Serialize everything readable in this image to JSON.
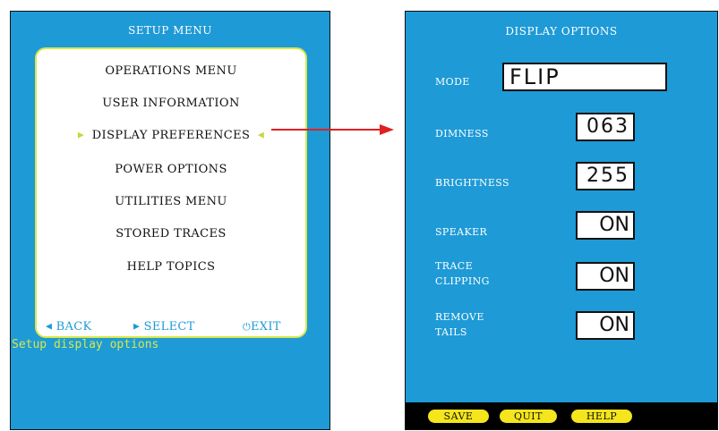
{
  "left": {
    "title": "SETUP MENU",
    "menu_items": [
      "OPERATIONS MENU",
      "USER INFORMATION",
      "DISPLAY PREFERENCES",
      "POWER OPTIONS",
      "UTILITIES MENU",
      "STORED TRACES",
      "HELP TOPICS"
    ],
    "selected_index": 2,
    "nav": {
      "back": "BACK",
      "select": "SELECT",
      "exit": "EXIT"
    },
    "status": "Setup display options"
  },
  "right": {
    "title": "DISPLAY OPTIONS",
    "options": [
      {
        "label": "MODE",
        "value": "FLIP"
      },
      {
        "label": "DIMNESS",
        "value": "063"
      },
      {
        "label": "BRIGHTNESS",
        "value": "255"
      },
      {
        "label": "SPEAKER",
        "value": "ON"
      },
      {
        "label": "TRACE CLIPPING",
        "label_lines": [
          "TRACE",
          "CLIPPING"
        ],
        "value": "ON"
      },
      {
        "label": "REMOVE TAILS",
        "label_lines": [
          "REMOVE",
          "TAILS"
        ],
        "value": "ON"
      }
    ],
    "buttons": {
      "save": "SAVE",
      "quit": "QUIT",
      "help": "HELP"
    }
  },
  "colors": {
    "screen_bg": "#1e9ad6",
    "menu_border": "#d6e84a",
    "status_text": "#d6e84a",
    "button_fill": "#f4e51c",
    "connector_arrow": "#e02020"
  },
  "icons": {
    "back": "triangle-left-icon",
    "select": "triangle-right-icon",
    "exit": "power-icon",
    "selection_markers": "triangle-markers-icon"
  }
}
